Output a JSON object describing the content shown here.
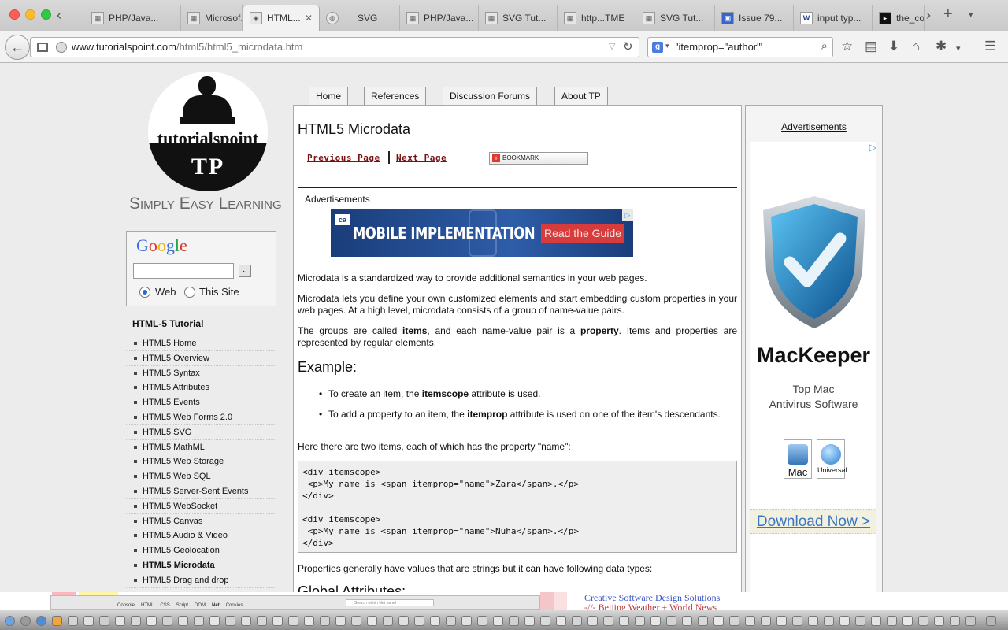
{
  "browser": {
    "tabs": [
      {
        "label": "PHP/Java...",
        "icon": "page-icon"
      },
      {
        "label": "Microsof...",
        "icon": "page-icon"
      },
      {
        "label": "HTML...",
        "icon": "tutorialspoint-icon",
        "active": true
      },
      {
        "label": "",
        "icon": "globe-icon"
      },
      {
        "label": "SVG",
        "icon": "globe-icon"
      },
      {
        "label": "PHP/Java...",
        "icon": "page-icon"
      },
      {
        "label": "SVG Tut...",
        "icon": "page-icon"
      },
      {
        "label": "http...TME",
        "icon": "page-icon"
      },
      {
        "label": "SVG Tut...",
        "icon": "page-icon"
      },
      {
        "label": "Issue 79...",
        "icon": "issue-icon"
      },
      {
        "label": "input typ...",
        "icon": "w3-icon"
      },
      {
        "label": "the_co",
        "icon": "terminal-icon"
      }
    ],
    "url_host": "www.tutorialspoint.com",
    "url_path": "/html5/html5_microdata.htm",
    "search_query": "'itemprop=\"author\"'",
    "search_engine_letter": "g"
  },
  "sidebar": {
    "tagline": "Simply Easy Learning",
    "logo_text": "tutorialspoint",
    "logo_tp": "TP",
    "google_search_btn": "..",
    "radio_web": "Web",
    "radio_site": "This Site",
    "menu_title": "HTML-5 Tutorial",
    "menu_items": [
      "HTML5 Home",
      "HTML5 Overview",
      "HTML5 Syntax",
      "HTML5 Attributes",
      "HTML5 Events",
      "HTML5 Web Forms 2.0",
      "HTML5 SVG",
      "HTML5 MathML",
      "HTML5 Web Storage",
      "HTML5 Web SQL",
      "HTML5 Server-Sent Events",
      "HTML5 WebSocket",
      "HTML5 Canvas",
      "HTML5 Audio & Video",
      "HTML5 Geolocation",
      "HTML5 Microdata",
      "HTML5 Drag and drop"
    ]
  },
  "topnav": [
    "Home",
    "References",
    "Discussion Forums",
    "About TP"
  ],
  "main": {
    "title": "HTML5 Microdata",
    "prev": "Previous Page",
    "next": "Next Page",
    "bookmark": "BOOKMARK",
    "ads_label": "Advertisements",
    "ad_brand": "ca",
    "ad_text": "MOBILE IMPLEMENTATION",
    "ad_cta": "Read the Guide",
    "p1": "Microdata is a standardized way to provide additional semantics in your web pages.",
    "p2": "Microdata lets you define your own customized elements and start embedding custom properties in your web pages. At a high level, microdata consists of a group of name-value pairs.",
    "p3_a": "The groups are called ",
    "p3_b": "items",
    "p3_c": ", and each name-value pair is a ",
    "p3_d": "property",
    "p3_e": ". Items and properties are represented by regular elements.",
    "example_heading": "Example:",
    "b1_a": "To create an item, the ",
    "b1_b": "itemscope",
    "b1_c": " attribute is used.",
    "b2_a": "To add a property to an item, the ",
    "b2_b": "itemprop",
    "b2_c": " attribute is used on one of the item's descendants.",
    "p4": "Here there are two items, each of which has the property \"name\":",
    "code": "<div itemscope>\n <p>My name is <span itemprop=\"name\">Zara</span>.</p>\n</div>\n\n<div itemscope>\n <p>My name is <span itemprop=\"name\">Nuha</span>.</p>\n</div>",
    "p5": "Properties generally have values that are strings but it can have following data types:",
    "global_heading": "Global Attributes:"
  },
  "right": {
    "ads_label": "Advertisements",
    "mk_title": "MacKeeper",
    "mk_sub1": "Top Mac",
    "mk_sub2": "Antivirus Software",
    "mk_mac": "Mac",
    "mk_univ": "Universal",
    "mk_download": "Download Now >"
  },
  "strip": {
    "dev_tabs": [
      "Console",
      "HTML",
      "CSS",
      "Script",
      "DOM",
      "Net",
      "Cookies"
    ],
    "dev_search": "Search within Net panel",
    "link1": "Creative Software Design Solutions",
    "link2": "-//- Beijing Weather + World News"
  }
}
